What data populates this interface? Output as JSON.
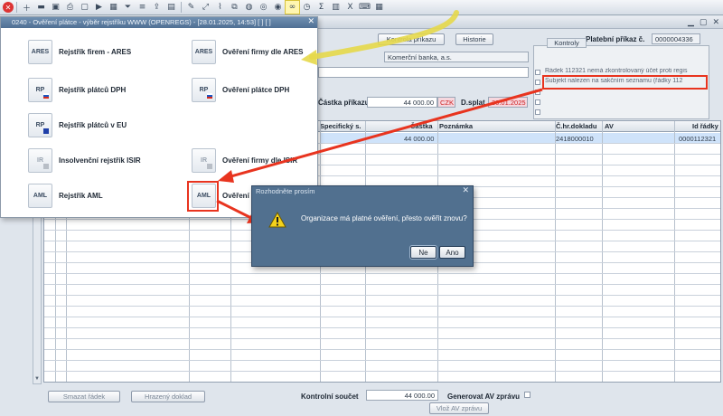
{
  "toolbar": {
    "icons": [
      "close-icon",
      "new-icon",
      "delete-icon",
      "save-icon",
      "print-icon",
      "disabled-icon",
      "play-icon",
      "calendar-icon",
      "filter-icon",
      "list-icon",
      "export-icon",
      "report-icon",
      "edit-icon",
      "link-icon",
      "attach-icon",
      "window-icon",
      "globe-icon",
      "compass-icon",
      "eye-icon",
      "binoculars-icon",
      "clock-icon",
      "sum-icon",
      "calc-icon",
      "excel-icon",
      "keyboard-icon",
      "grid-icon"
    ]
  },
  "main": {
    "title": "0240 - Ověření plátce - výběr rejstříku WWW (OPENREGS) - [28.01.2025, 14:53] [ ] [ ]",
    "btn_kontrola": "Kontrola příkazu",
    "btn_historie": "Historie",
    "platebni_label": "Platební příkaz č.",
    "platebni_value": "0000004336",
    "bank_value": "Komerční banka, a.s.",
    "castka_label": "Částka příkazu",
    "castka_value": "44 000.00",
    "currency": "CZK",
    "dsplat_label": "D.splat",
    "dsplat_value": "30.01.2025",
    "kontroly": {
      "tab": "Kontroly",
      "row1": "Řádek 112321 nemá zkontrolovaný účet proti regis",
      "row2": "Subjekt nalezen na sakčním seznamu (řádky 112"
    },
    "grid": {
      "headers": {
        "specificky": "Specifický s.",
        "castka": "Částka",
        "poznamka": "Poznámka",
        "chr": "Č.hr.dokladu",
        "av": "AV",
        "id": "Id řádky"
      },
      "row": {
        "castka": "44 000.00",
        "chr": "2418000010",
        "id": "0000112321"
      }
    },
    "bottom": {
      "btn_smazat": "Smazat řádek",
      "btn_hrazeny": "Hrazený doklad",
      "kontrolni_label": "Kontrolní součet",
      "kontrolni_value": "44 000.00",
      "generovat_label": "Generovat AV zprávu",
      "btn_vloz": "Vlož AV zprávu"
    }
  },
  "popup": {
    "title": "0240 - Ověření plátce - výběr rejstříku WWW (OPENREGS) - [28.01.2025, 14:53] [ ] [ ]",
    "items": [
      {
        "icon_text": "ARES",
        "label": "Rejstřík firem - ARES"
      },
      {
        "icon_text": "ARES",
        "label": "Ověření firmy dle ARES"
      },
      {
        "icon_text": "RP",
        "label": "Rejstřík plátců DPH"
      },
      {
        "icon_text": "RP",
        "label": "Ověření plátce DPH"
      },
      {
        "icon_text": "RP",
        "label": "Rejstřík plátců v EU"
      },
      {
        "icon_text": "IR",
        "label": "Insolvenční rejstřík ISIR"
      },
      {
        "icon_text": "IR",
        "label": "Ověření firmy dle ISIR"
      },
      {
        "icon_text": "AML",
        "label": "Rejstřík AML"
      },
      {
        "icon_text": "AML",
        "label": "Ověření"
      }
    ]
  },
  "dialog": {
    "title": "Rozhodněte prosím",
    "message": "Organizace má platné ověření, přesto ověřit znovu?",
    "btn_no": "Ne",
    "btn_yes": "Ano"
  },
  "colors": {
    "annotation_red": "#e8341f",
    "annotation_yellow": "#e5d84a",
    "dialog_bg": "#51708f",
    "selection": "#cfe3fa"
  }
}
